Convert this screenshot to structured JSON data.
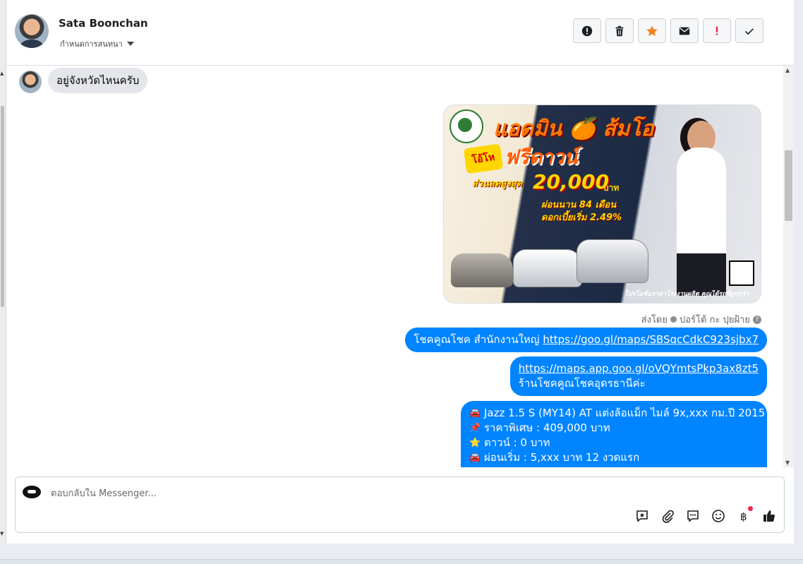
{
  "header": {
    "user_name": "Sata Boonchan",
    "assign_label": "กำหนดการสนทนา",
    "toolbar": [
      {
        "name": "spam-button",
        "icon": "alert-circle-icon"
      },
      {
        "name": "delete-button",
        "icon": "trash-icon"
      },
      {
        "name": "star-button",
        "icon": "star-icon"
      },
      {
        "name": "mark-unread-button",
        "icon": "envelope-icon"
      },
      {
        "name": "follow-up-button",
        "icon": "exclamation-icon"
      },
      {
        "name": "mark-done-button",
        "icon": "check-icon"
      }
    ]
  },
  "chat": {
    "incoming": {
      "text": "อยู่จังหวัดไหนครับ"
    },
    "ad_image": {
      "title": "แอดมิน 🍊 ส้มโอ",
      "badge": "โอ้โห",
      "headline": "ฟรีดาวน์",
      "discount_label": "ส่วนลดสูงสุด",
      "amount": "20,000",
      "amount_unit": "บาท",
      "months": "ผ่อนนาน 84 เดือน",
      "rate": "ดอกเบี้ยเริ่ม 2.49%",
      "footer": "โปรโมชั่นราคาโรงงานผลิต คุณได้รถที่ถูกกว่า"
    },
    "sent_by": {
      "prefix": "ส่งโดย",
      "agent": "ปอร์โต้ กะ ปุยฝ้าย"
    },
    "outgoing": [
      {
        "text": "โชคคูณโชค สำนักงานใหญ่ ",
        "link": "https://goo.gl/maps/SBSqcCdkC923sjbx7"
      },
      {
        "link": "https://maps.app.goo.gl/oVQYmtsPkp3ax8zt5",
        "text": "ร้านโชคคูณโชคอุดรธานีค่ะ"
      }
    ],
    "car_details": [
      {
        "emoji": "🚘",
        "text": "Jazz 1.5 S (MY14) AT แต่งล้อแม็ก ไมล์ 9x,xxx กม.ปี 2015"
      },
      {
        "emoji": "📌",
        "text": "ราคาพิเศษ : 409,000 บาท"
      },
      {
        "emoji": "⭐",
        "text": "ดาวน์ : 0 บาท"
      },
      {
        "emoji": "🚘",
        "text": "ผ่อนเริ่ม : 5,xxx บาท 12 งวดแรก"
      }
    ]
  },
  "composer": {
    "placeholder": "ตอบกลับใน Messenger...",
    "icons": [
      "saved-reply-icon",
      "paperclip-icon",
      "chat-bubble-icon",
      "emoji-icon",
      "baht-icon",
      "thumbs-up-icon"
    ]
  },
  "colors": {
    "accent": "#0084ff",
    "star": "#f5821f",
    "alert": "#e41e3f"
  }
}
